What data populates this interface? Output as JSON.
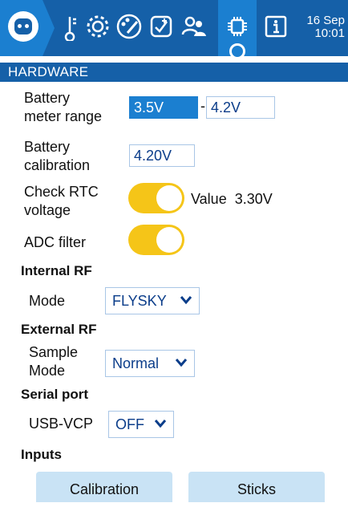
{
  "top_bar": {
    "date": "16 Sep",
    "time": "10:01",
    "tabs": [
      "radio-logo-icon",
      "gear-check-icon",
      "settings-gear-icon",
      "theme-palette-icon",
      "checklist-icon",
      "users-icon",
      "hardware-chip-icon",
      "info-icon"
    ]
  },
  "section": {
    "title": "HARDWARE"
  },
  "battery_meter": {
    "label_line1": "Battery",
    "label_line2": "meter range",
    "min": "3.5V",
    "separator": "-",
    "max": "4.2V"
  },
  "battery_calibration": {
    "label_line1": "Battery",
    "label_line2": "calibration",
    "value": "4.20V"
  },
  "rtc": {
    "label_line1": "Check RTC",
    "label_line2": "voltage",
    "enabled": true,
    "value_text": "Value  3.30V"
  },
  "adc": {
    "label": "ADC filter",
    "enabled": true
  },
  "internal_rf": {
    "heading": "Internal RF",
    "mode_label": "Mode",
    "mode_value": "FLYSKY"
  },
  "external_rf": {
    "heading": "External RF",
    "sample_label_line1": "Sample",
    "sample_label_line2": "Mode",
    "sample_value": "Normal"
  },
  "serial": {
    "heading": "Serial port",
    "usb_label": "USB-VCP",
    "usb_value": "OFF"
  },
  "inputs": {
    "heading": "Inputs",
    "calibration_button": "Calibration",
    "sticks_button": "Sticks"
  },
  "colors": {
    "header_blue": "#1560a8",
    "active_blue": "#1b7fd0",
    "toggle_on": "#f5c518",
    "button_bg": "#c9e3f5"
  }
}
